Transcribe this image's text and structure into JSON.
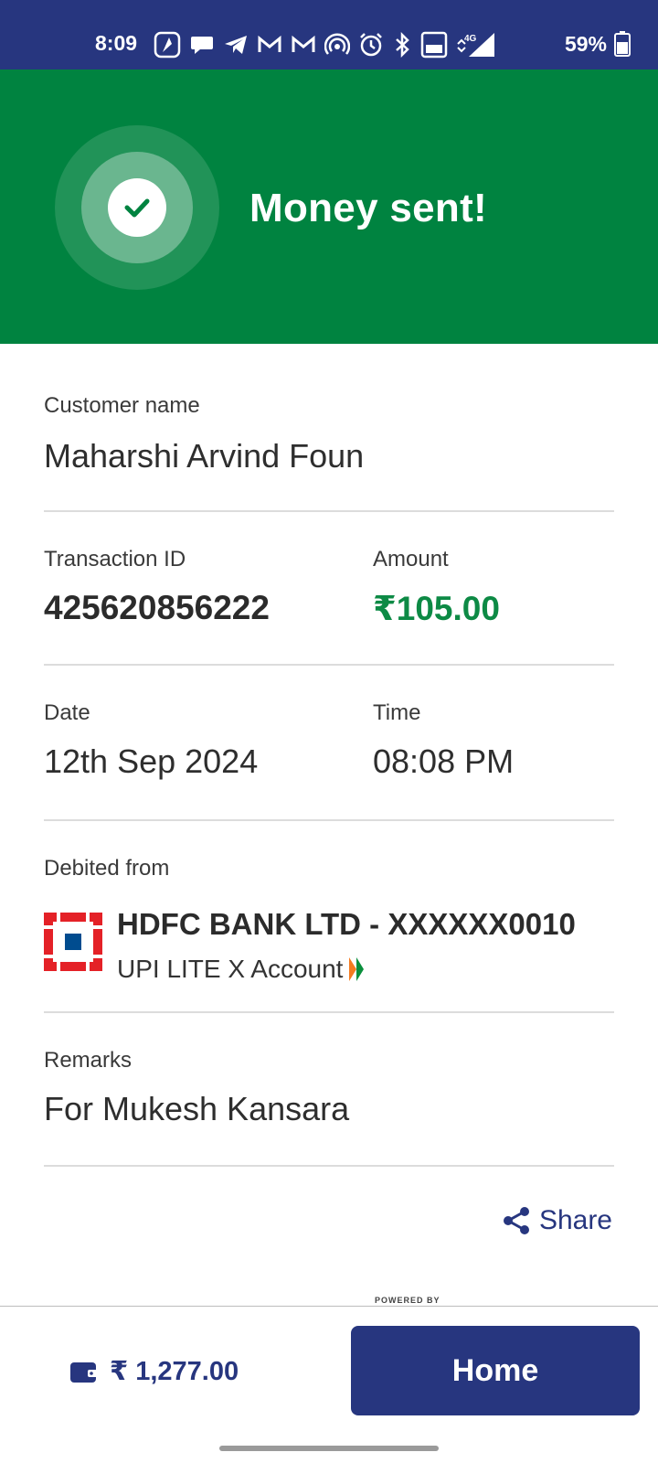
{
  "status_bar": {
    "time": "8:09",
    "battery_percent": "59%",
    "network": "4G",
    "icons": [
      "navigation-app-icon",
      "chat-icon",
      "telegram-icon",
      "gmail-icon",
      "gmail-icon",
      "hotspot-icon",
      "alarm-icon",
      "bluetooth-icon",
      "volte-icon",
      "signal-icon",
      "battery-icon"
    ]
  },
  "banner": {
    "title": "Money sent!",
    "icon": "check-icon",
    "color": "#008340"
  },
  "details": {
    "customer_label": "Customer name",
    "customer_value": "Maharshi Arvind Foun",
    "txn_label": "Transaction ID",
    "txn_value": "425620856222",
    "amount_label": "Amount",
    "amount_value": "₹105.00",
    "date_label": "Date",
    "date_value": "12th Sep 2024",
    "time_label": "Time",
    "time_value": "08:08 PM",
    "debited_label": "Debited from",
    "bank_name": "HDFC BANK LTD - XXXXXX0010",
    "bank_account_type": "UPI LITE X Account",
    "remarks_label": "Remarks",
    "remarks_value": "For Mukesh Kansara"
  },
  "actions": {
    "share_label": "Share",
    "home_label": "Home"
  },
  "footer": {
    "powered_by": "POWERED BY",
    "wallet_balance": "₹ 1,277.00"
  },
  "colors": {
    "primary": "#27367f",
    "success": "#008340",
    "amount_green": "#0d8a45"
  }
}
